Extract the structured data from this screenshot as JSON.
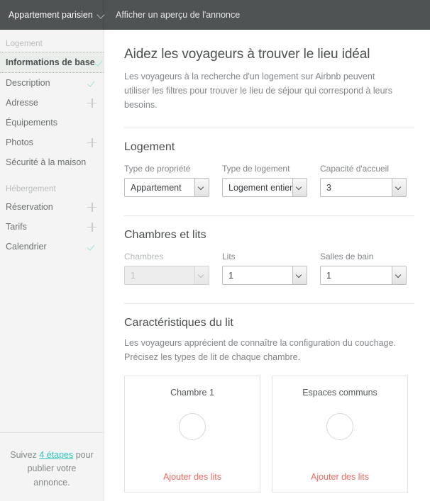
{
  "topbar": {
    "listing_title": "Appartement parisien",
    "listing_chevron_icon": "chevron-down-icon",
    "preview_label": "Afficher un aperçu de l'annonce"
  },
  "sidebar": {
    "groups": [
      {
        "label": "Logement",
        "items": [
          {
            "label": "Informations de base",
            "status_icon": "check-icon",
            "active": true
          },
          {
            "label": "Description",
            "status_icon": "check-icon",
            "active": false
          },
          {
            "label": "Adresse",
            "status_icon": "plus-icon",
            "active": false
          },
          {
            "label": "Équipements",
            "status_icon": "none",
            "active": false
          },
          {
            "label": "Photos",
            "status_icon": "plus-icon",
            "active": false
          },
          {
            "label": "Sécurité à la maison",
            "status_icon": "none",
            "active": false
          }
        ]
      },
      {
        "label": "Hébergement",
        "items": [
          {
            "label": "Réservation",
            "status_icon": "plus-icon",
            "active": false
          },
          {
            "label": "Tarifs",
            "status_icon": "plus-icon",
            "active": false
          },
          {
            "label": "Calendrier",
            "status_icon": "check-icon",
            "active": false
          }
        ]
      }
    ],
    "footer": {
      "before_link": "Suivez ",
      "link": "4 étapes",
      "after_link": " pour publier votre annonce."
    }
  },
  "main": {
    "title": "Aidez les voyageurs à trouver le lieu idéal",
    "subtitle": "Les voyageurs à la recherche d'un logement sur Airbnb peuvent utiliser les filtres pour trouver le lieu de séjour qui correspond à leurs besoins.",
    "sections": [
      {
        "title": "Logement",
        "fields": [
          {
            "label": "Type de propriété",
            "value": "Appartement",
            "disabled": false
          },
          {
            "label": "Type de logement",
            "value": "Logement entier",
            "disabled": false
          },
          {
            "label": "Capacité d'accueil",
            "value": "3",
            "disabled": false
          }
        ]
      },
      {
        "title": "Chambres et lits",
        "fields": [
          {
            "label": "Chambres",
            "value": "1",
            "disabled": true
          },
          {
            "label": "Lits",
            "value": "1",
            "disabled": false
          },
          {
            "label": "Salles de bain",
            "value": "1",
            "disabled": false
          }
        ]
      },
      {
        "title": "Caractéristiques du lit",
        "description": "Les voyageurs apprécient de connaître la configuration du couchage. Précisez les types de lit de chaque chambre.",
        "cards": [
          {
            "title": "Chambre 1",
            "link": "Ajouter des lits",
            "circle_icon": "bed-placeholder-circle-icon"
          },
          {
            "title": "Espaces communs",
            "link": "Ajouter des lits",
            "circle_icon": "bed-placeholder-circle-icon"
          }
        ]
      }
    ]
  },
  "colors": {
    "topbar_bg": "#4f5354",
    "sidebar_bg": "#f4f4f4",
    "active_item_bg": "#eaeeea",
    "check_teal": "#9fe0dc",
    "link_teal": "#2ec4c0",
    "link_salmon": "#ef6b60",
    "text_primary": "#4a4e4f",
    "text_muted": "#82868a"
  }
}
